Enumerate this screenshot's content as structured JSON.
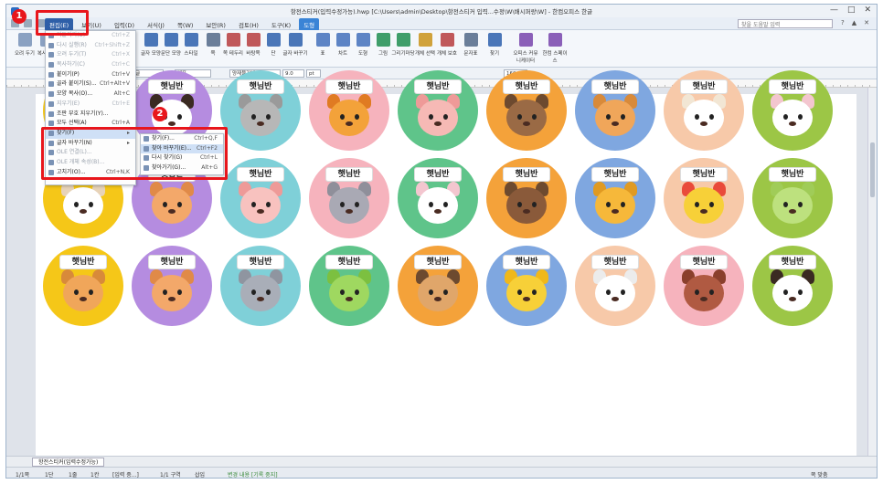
{
  "window": {
    "title": "항전스티커(입력수정가능).hwp [C:\\Users\\admin\\Desktop\\항전스티커 입력...수정\\W\\배시퍼랑\\W] - 한컴오피스 한글",
    "controls": [
      "—",
      "□",
      "✕"
    ]
  },
  "menubar": {
    "items": [
      {
        "label": "편집(E)",
        "state": "active"
      },
      {
        "label": "보기(U)",
        "state": ""
      },
      {
        "label": "입력(D)",
        "state": ""
      },
      {
        "label": "서식(J)",
        "state": ""
      },
      {
        "label": "쪽(W)",
        "state": ""
      },
      {
        "label": "보안(R)",
        "state": ""
      },
      {
        "label": "검토(H)",
        "state": ""
      },
      {
        "label": "도구(K)",
        "state": ""
      },
      {
        "label": "도형",
        "state": "tool"
      }
    ],
    "help_placeholder": "찾을 도움말 입력",
    "right_icons": [
      "?",
      "▲",
      "✕"
    ]
  },
  "ribbon": {
    "buttons": [
      {
        "label": "오려 두기",
        "color": "#8aa1c2"
      },
      {
        "label": "복사하기",
        "color": "#8aa1c2"
      },
      {
        "label": "붙이기",
        "color": "#8aa1c2"
      },
      {
        "label": "모양 복사",
        "color": "#8aa1c2"
      },
      {
        "label": "글자 모양",
        "color": "#4a76b8"
      },
      {
        "label": "문단 모양",
        "color": "#4a76b8"
      },
      {
        "label": "스타일",
        "color": "#4a76b8"
      },
      {
        "label": "쪽",
        "color": "#6a7e99"
      },
      {
        "label": "쪽 테두리",
        "color": "#c0585a"
      },
      {
        "label": "바탕쪽",
        "color": "#c0585a"
      },
      {
        "label": "단",
        "color": "#4a76b8"
      },
      {
        "label": "글자 바꾸기",
        "color": "#4a76b8"
      },
      {
        "label": "표",
        "color": "#5d84c5"
      },
      {
        "label": "차트",
        "color": "#5d84c5"
      },
      {
        "label": "도형",
        "color": "#5d84c5"
      },
      {
        "label": "그림",
        "color": "#3f9e6a"
      },
      {
        "label": "그리기마당",
        "color": "#3f9e6a"
      },
      {
        "label": "개체 선택",
        "color": "#d0a23b"
      },
      {
        "label": "개체 보호",
        "color": "#c0585a"
      },
      {
        "label": "문자표",
        "color": "#6a7e99"
      },
      {
        "label": "찾기",
        "color": "#4a76b8"
      },
      {
        "label": "오피스 커뮤니케이터",
        "color": "#8a5fb8"
      },
      {
        "label": "한컴 스페이스",
        "color": "#8a5fb8"
      }
    ]
  },
  "formatbar": {
    "style": "바탕글",
    "font_lang": "대표",
    "font": "양재블기체M",
    "size": "9.0",
    "unit": "pt",
    "zoom": "160"
  },
  "stickers": {
    "label": "햇님반",
    "items": [
      {
        "bg": "#f5c718",
        "face": "#f3c89a",
        "ear": "#3a2a22"
      },
      {
        "bg": "#b58ce0",
        "face": "#ffffff",
        "ear": "#3a2a22"
      },
      {
        "bg": "#7fd0d8",
        "face": "#b7b7b7",
        "ear": "#9a9a9a"
      },
      {
        "bg": "#f6b3bd",
        "face": "#f3a23a",
        "ear": "#e07b22"
      },
      {
        "bg": "#5fc48a",
        "face": "#f6b9b5",
        "ear": "#ee9a98"
      },
      {
        "bg": "#f4a23a",
        "face": "#9a6a45",
        "ear": "#6d4a2f"
      },
      {
        "bg": "#7fa7e0",
        "face": "#f0a65a",
        "ear": "#d88a3a"
      },
      {
        "bg": "#f7c9a9",
        "face": "#ffffff",
        "ear": "#f2e6d4"
      },
      {
        "bg": "#9cc646",
        "face": "#ffffff",
        "ear": "#f3c6cf"
      },
      {
        "bg": "#f5c718",
        "face": "#ffffff",
        "ear": "#e7d3b8"
      },
      {
        "bg": "#b58ce0",
        "face": "#f3a86a",
        "ear": "#e08a48"
      },
      {
        "bg": "#7fd0d8",
        "face": "#f8c2bf",
        "ear": "#ee9a98"
      },
      {
        "bg": "#f6b3bd",
        "face": "#a9a9b4",
        "ear": "#8f8f9a"
      },
      {
        "bg": "#5fc48a",
        "face": "#ffffff",
        "ear": "#f3c6cf"
      },
      {
        "bg": "#f4a23a",
        "face": "#8a5a3a",
        "ear": "#6d4a2f"
      },
      {
        "bg": "#7fa7e0",
        "face": "#f6b83a",
        "ear": "#e09a22"
      },
      {
        "bg": "#f7c9a9",
        "face": "#f7d038",
        "ear": "#e94a3a"
      },
      {
        "bg": "#9cc646",
        "face": "#bde17e",
        "ear": "#a0cc58"
      },
      {
        "bg": "#f5c718",
        "face": "#f0a65a",
        "ear": "#d88a3a"
      },
      {
        "bg": "#b58ce0",
        "face": "#f3a86a",
        "ear": "#e08a48"
      },
      {
        "bg": "#7fd0d8",
        "face": "#a9aeb8",
        "ear": "#8f95a0"
      },
      {
        "bg": "#5fc48a",
        "face": "#9fd860",
        "ear": "#7cc040"
      },
      {
        "bg": "#f4a23a",
        "face": "#e0a66a",
        "ear": "#6d4a2f"
      },
      {
        "bg": "#7fa7e0",
        "face": "#f7d038",
        "ear": "#f0b81a"
      },
      {
        "bg": "#f7c9a9",
        "face": "#ffffff",
        "ear": "#ececec"
      },
      {
        "bg": "#f6b3bd",
        "face": "#b05a42",
        "ear": "#8a3f2c"
      },
      {
        "bg": "#9cc646",
        "face": "#ffffff",
        "ear": "#3a2a22"
      }
    ]
  },
  "edit_menu": {
    "items": [
      {
        "label": "되돌리기(U)",
        "shortcut": "Ctrl+Z",
        "disabled": true
      },
      {
        "label": "다시 실행(R)",
        "shortcut": "Ctrl+Shift+Z",
        "disabled": true
      },
      {
        "label": "오려 두기(T)",
        "shortcut": "Ctrl+X",
        "disabled": true
      },
      {
        "label": "복사하기(C)",
        "shortcut": "Ctrl+C",
        "disabled": true
      },
      {
        "label": "붙이기(P)",
        "shortcut": "Ctrl+V",
        "disabled": false
      },
      {
        "label": "골라 붙이기(S)...",
        "shortcut": "Ctrl+Alt+V",
        "disabled": false
      },
      {
        "label": "모양 복사(O)...",
        "shortcut": "Alt+C",
        "disabled": false
      },
      {
        "label": "지우기(E)",
        "shortcut": "Ctrl+E",
        "disabled": true
      },
      {
        "label": "조판 부호 지우기(Y)...",
        "shortcut": "",
        "disabled": false
      },
      {
        "label": "모두 선택(A)",
        "shortcut": "Ctrl+A",
        "disabled": false
      },
      {
        "label": "찾기(F)",
        "shortcut": "▸",
        "disabled": false,
        "highlight": true
      },
      {
        "label": "글자 바꾸기(N)",
        "shortcut": "▸",
        "disabled": false
      },
      {
        "label": "OLE 연결(L)...",
        "shortcut": "",
        "disabled": true
      },
      {
        "label": "OLE 개체 속성(B)...",
        "shortcut": "",
        "disabled": true
      },
      {
        "label": "고치기(O)...",
        "shortcut": "Ctrl+N,K",
        "disabled": false
      }
    ]
  },
  "find_submenu": {
    "items": [
      {
        "label": "찾기(F)...",
        "shortcut": "Ctrl+Q,F",
        "highlight": false
      },
      {
        "label": "찾아 바꾸기(E)...",
        "shortcut": "Ctrl+F2",
        "highlight": true
      },
      {
        "label": "다시 찾기(G)",
        "shortcut": "Ctrl+L",
        "highlight": false
      },
      {
        "label": "찾아가기(G)...",
        "shortcut": "Alt+G",
        "highlight": false
      }
    ]
  },
  "annotations": {
    "step1": "1",
    "step2": "2"
  },
  "sheet_tab": "항전스티커(입력수정가능)",
  "statusbar": {
    "items": [
      "1/1쪽",
      "1단",
      "1줄",
      "1칸",
      "[입력 중...]",
      "1/1 구역",
      "삽입",
      "변경 내용 [기록 중지]"
    ],
    "zoom": "쪽 맞춤"
  }
}
